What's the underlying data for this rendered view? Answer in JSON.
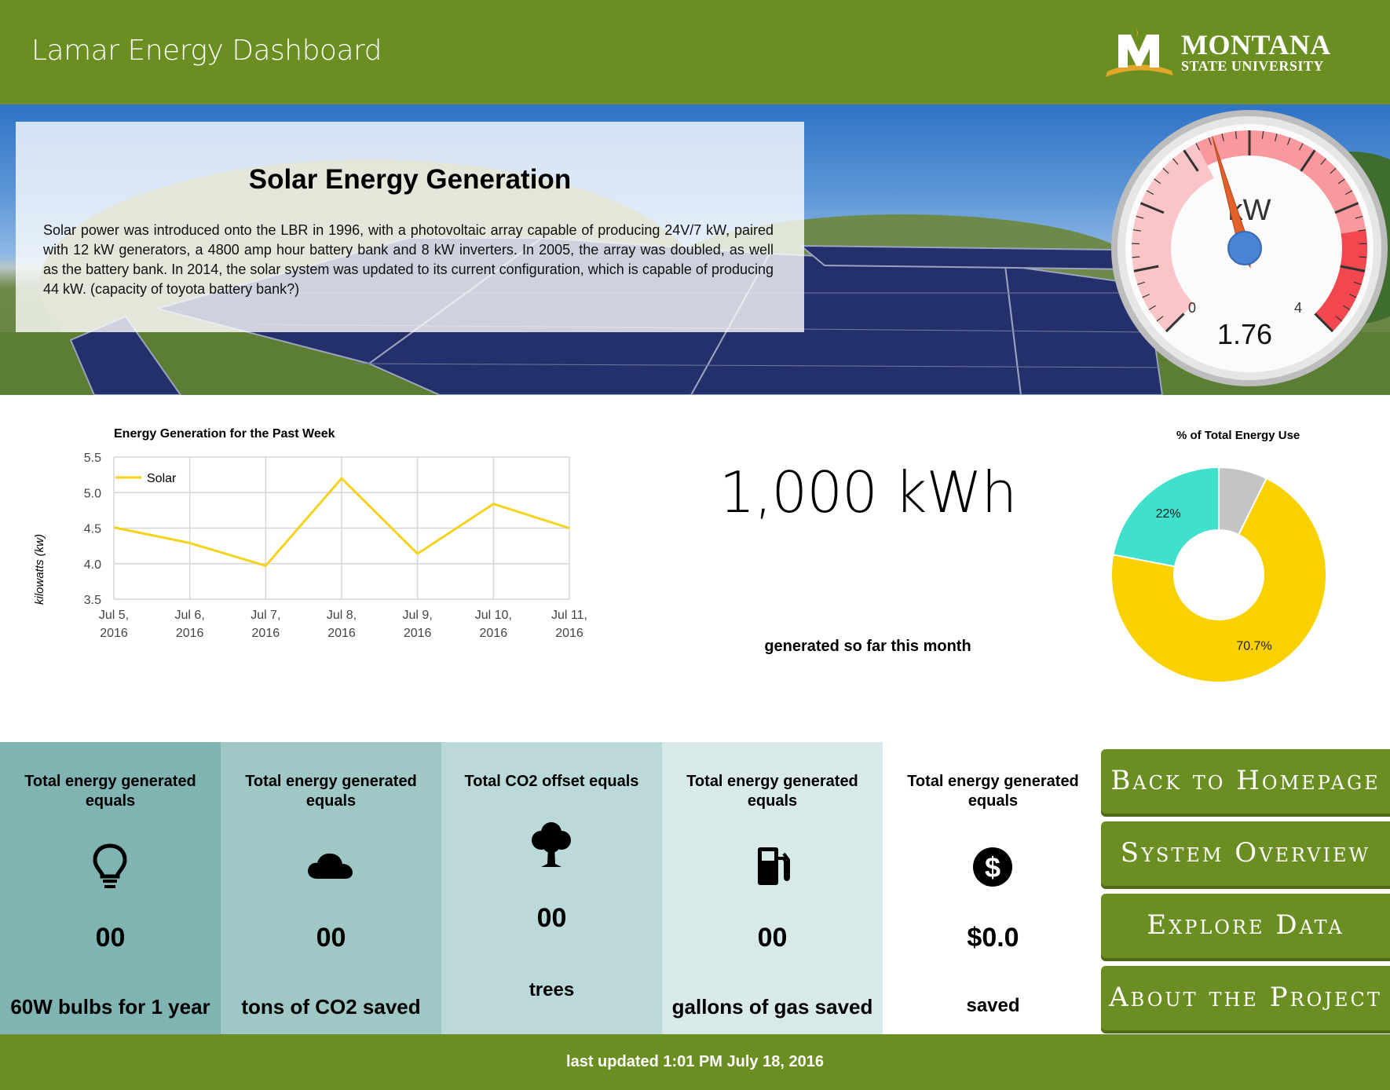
{
  "header": {
    "title": "Lamar Energy Dashboard",
    "logo_line1": "MONTANA",
    "logo_line2": "STATE UNIVERSITY"
  },
  "intro": {
    "title": "Solar Energy Generation",
    "text": "Solar power was introduced onto the LBR in 1996, with a photovoltaic array capable of producing 24V/7 kW, paired with 12 kW generators, a 4800 amp hour battery bank and 8 kW inverters. In 2005, the array was doubled, as well as the battery bank. In 2014, the solar system was updated to its current configuration, which is capable of producing 44 kW. (capacity of toyota battery bank?)"
  },
  "gauge": {
    "unit": "kW",
    "min_label": "0",
    "max_label": "4",
    "value": "1.76",
    "value_num": 1.76,
    "min": 0,
    "max": 4
  },
  "chart_data": [
    {
      "type": "line",
      "title": "Energy Generation for the Past Week",
      "ylabel": "kilowatts (kw)",
      "xlabel": "",
      "categories": [
        "Jul 5, 2016",
        "Jul 6, 2016",
        "Jul 7, 2016",
        "Jul 8, 2016",
        "Jul 9, 2016",
        "Jul 10, 2016",
        "Jul 11, 2016"
      ],
      "series": [
        {
          "name": "Solar",
          "values": [
            4.51,
            4.29,
            3.97,
            5.2,
            4.14,
            4.84,
            4.5
          ],
          "color": "#f5d21c"
        }
      ],
      "ylim": [
        3.5,
        5.5
      ],
      "yticks": [
        "3.5",
        "4.0",
        "4.5",
        "5.0",
        "5.5"
      ],
      "grid": true,
      "legend": "top-left"
    },
    {
      "type": "pie",
      "title": "% of Total Energy Use",
      "slices": [
        {
          "label": "70.7%",
          "value": 70.7,
          "color": "#f9d100"
        },
        {
          "label": "22%",
          "value": 22,
          "color": "#3fe0cc"
        },
        {
          "label": "",
          "value": 7.3,
          "color": "#c4c4c4"
        }
      ]
    }
  ],
  "monthly": {
    "value": "1,000 kWh",
    "caption": "generated so far this month"
  },
  "tiles": [
    {
      "heading": "Total energy generated equals",
      "value": "00",
      "label": "60W bulbs for 1 year",
      "icon": "lightbulb-icon",
      "bg": "#80b4b3"
    },
    {
      "heading": "Total energy generated equals",
      "value": "00",
      "label": "tons of CO2 saved",
      "icon": "cloud-icon",
      "bg": "#9fc7c6"
    },
    {
      "heading": "Total CO2 offset equals",
      "value": "00",
      "label": "trees",
      "icon": "tree-icon",
      "bg": "#bad9d8"
    },
    {
      "heading": "Total energy generated equals",
      "value": "00",
      "label": "gallons of gas saved",
      "icon": "gas-pump-icon",
      "bg": "#d7eae9"
    },
    {
      "heading": "Total energy generated equals",
      "value": "$0.0",
      "label": "saved",
      "icon": "dollar-icon",
      "bg": "#ffffff"
    }
  ],
  "nav": {
    "back_home": "Back to Homepage",
    "system_overview": "System Overview",
    "explore_data": "Explore Data",
    "about_project": "About the Project",
    "color": "#6b8e23"
  },
  "footer": {
    "text": "last updated 1:01 PM July 18, 2016"
  }
}
